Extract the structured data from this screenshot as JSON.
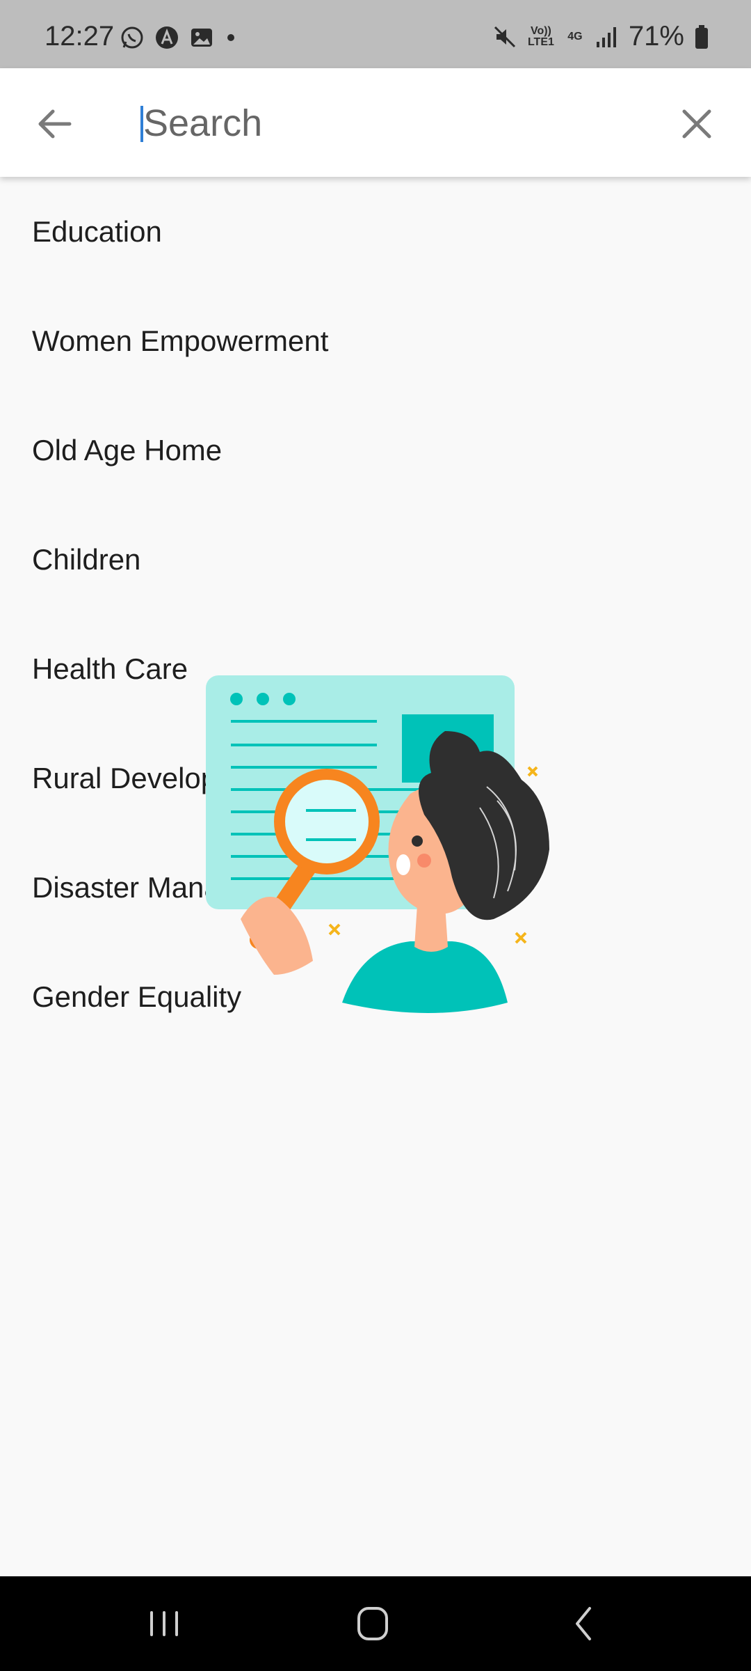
{
  "status_bar": {
    "time": "12:27",
    "battery": "71%",
    "left_icons": [
      "whatsapp-icon",
      "maps-a-icon",
      "gallery-icon",
      "dot-icon"
    ],
    "right_icons": [
      "mute-icon",
      "volte-icon",
      "4g-icon",
      "signal-icon",
      "battery-icon"
    ],
    "volte_label": "Vo)) LTE1",
    "net_label": "4G"
  },
  "search": {
    "placeholder": "Search",
    "value": ""
  },
  "categories": [
    "Education",
    "Women Empowerment",
    "Old Age Home",
    "Children",
    "Health Care",
    "Rural Development",
    "Disaster Management",
    "Gender Equality"
  ],
  "colors": {
    "accent": "#2f7fd6",
    "illustration_teal": "#00c2b8",
    "illustration_card": "#a9ede7",
    "magnifier": "#f7851f"
  }
}
